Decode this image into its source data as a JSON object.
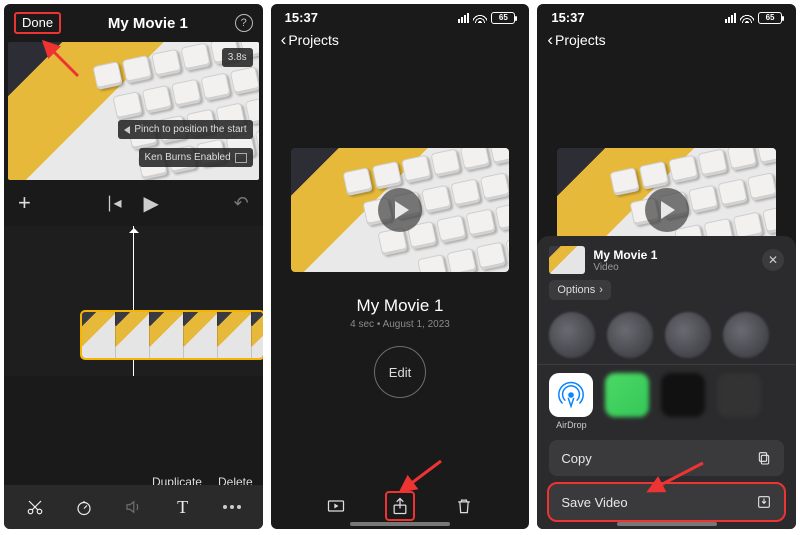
{
  "status": {
    "time": "15:37",
    "battery": "65"
  },
  "nav": {
    "back_label": "Projects"
  },
  "panel1": {
    "done": "Done",
    "title": "My Movie 1",
    "duration": "3.8s",
    "pinch_hint": "Pinch to position the start",
    "ken_burns": "Ken Burns Enabled",
    "duplicate": "Duplicate",
    "delete": "Delete"
  },
  "panel2": {
    "title": "My Movie 1",
    "subtitle": "4 sec • August 1, 2023",
    "edit": "Edit"
  },
  "panel3": {
    "sheet_title": "My Movie 1",
    "sheet_sub": "Video",
    "options": "Options",
    "airdrop": "AirDrop",
    "copy": "Copy",
    "save_video": "Save Video"
  },
  "colors": {
    "highlight": "#e33"
  }
}
